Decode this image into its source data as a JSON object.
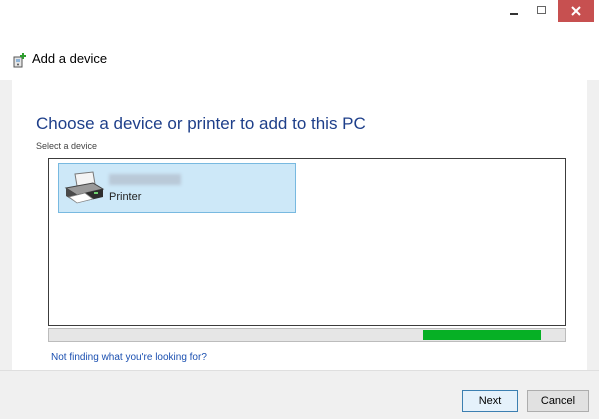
{
  "window": {
    "controls": {
      "minimize_icon": "minimize-icon",
      "maximize_icon": "maximize-icon",
      "close_icon": "close-icon",
      "close_color": "#c75050"
    }
  },
  "header": {
    "icon": "add-device-icon",
    "title": "Add a device"
  },
  "main": {
    "heading": "Choose a device or printer to add to this PC",
    "subheading": "Select a device",
    "devices": [
      {
        "name": "",
        "type": "Printer",
        "icon": "printer-icon",
        "selected": true
      }
    ],
    "progress": {
      "color": "#06b025",
      "indeterminate": true
    },
    "help_link": "Not finding what you're looking for?"
  },
  "footer": {
    "next_label": "Next",
    "cancel_label": "Cancel"
  },
  "colors": {
    "accent": "#1e3f8a",
    "link": "#1a4fb0",
    "selection_bg": "#cde8f8"
  }
}
